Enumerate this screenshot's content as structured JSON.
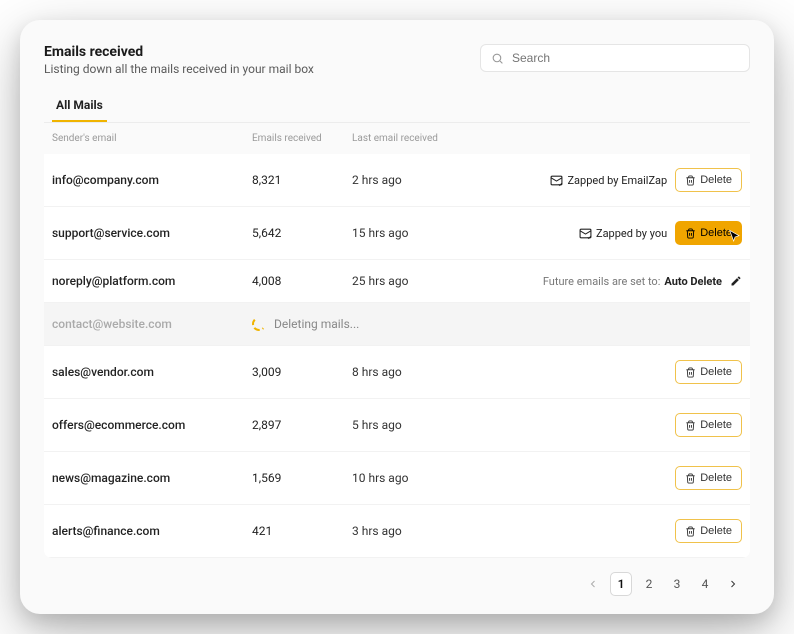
{
  "header": {
    "title": "Emails received",
    "subtitle": "Listing down all the mails received in your mail box"
  },
  "search": {
    "placeholder": "Search"
  },
  "tabs": {
    "all": "All Mails"
  },
  "columns": {
    "sender": "Sender's email",
    "count": "Emails received",
    "last": "Last email received"
  },
  "status_labels": {
    "zapped_by_emailzap": "Zapped by EmailZap",
    "zapped_by_you": "Zapped by you",
    "future_prefix": "Future emails are set to:",
    "auto_delete": "Auto Delete"
  },
  "buttons": {
    "delete": "Delete"
  },
  "deleting_text": "Deleting mails...",
  "rows": [
    {
      "sender": "info@company.com",
      "count": "8,321",
      "last": "2 hrs ago",
      "status": "zapped_emailzap",
      "delete_btn": true
    },
    {
      "sender": "support@service.com",
      "count": "5,642",
      "last": "15 hrs ago",
      "status": "zapped_you",
      "delete_btn": true,
      "delete_active": true
    },
    {
      "sender": "noreply@platform.com",
      "count": "4,008",
      "last": "25 hrs ago",
      "status": "auto_delete"
    },
    {
      "sender": "contact@website.com",
      "deleting": true
    },
    {
      "sender": "sales@vendor.com",
      "count": "3,009",
      "last": "8 hrs ago",
      "delete_btn": true
    },
    {
      "sender": "offers@ecommerce.com",
      "count": "2,897",
      "last": "5 hrs ago",
      "delete_btn": true
    },
    {
      "sender": "news@magazine.com",
      "count": "1,569",
      "last": "10 hrs ago",
      "delete_btn": true
    },
    {
      "sender": "alerts@finance.com",
      "count": "421",
      "last": "3 hrs ago",
      "delete_btn": true
    }
  ],
  "pagination": {
    "pages": [
      "1",
      "2",
      "3",
      "4"
    ],
    "current": "1"
  }
}
